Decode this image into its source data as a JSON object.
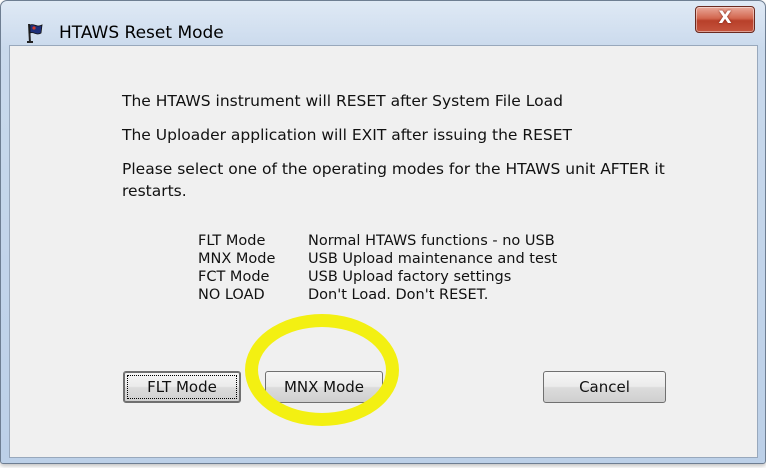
{
  "window": {
    "title": "HTAWS Reset Mode",
    "close_label": "X"
  },
  "messages": {
    "line1": "The HTAWS instrument will RESET after System File Load",
    "line2": "The Uploader application will EXIT after issuing the RESET",
    "line3a": "Please select one of the operating modes for the HTAWS unit AFTER it",
    "line3b": "restarts."
  },
  "modes": [
    {
      "name": "FLT Mode",
      "desc": "Normal HTAWS functions - no USB"
    },
    {
      "name": "MNX Mode",
      "desc": "USB Upload maintenance and test"
    },
    {
      "name": "FCT Mode",
      "desc": "USB Upload factory settings"
    },
    {
      "name": "NO LOAD",
      "desc": "Don't Load. Don't RESET."
    }
  ],
  "buttons": {
    "flt": "FLT Mode",
    "mnx": "MNX Mode",
    "cancel": "Cancel"
  },
  "annotation": {
    "color": "#f3f012",
    "target": "MNX Mode"
  },
  "icons": {
    "app": "flag-icon",
    "close": "close-icon"
  }
}
